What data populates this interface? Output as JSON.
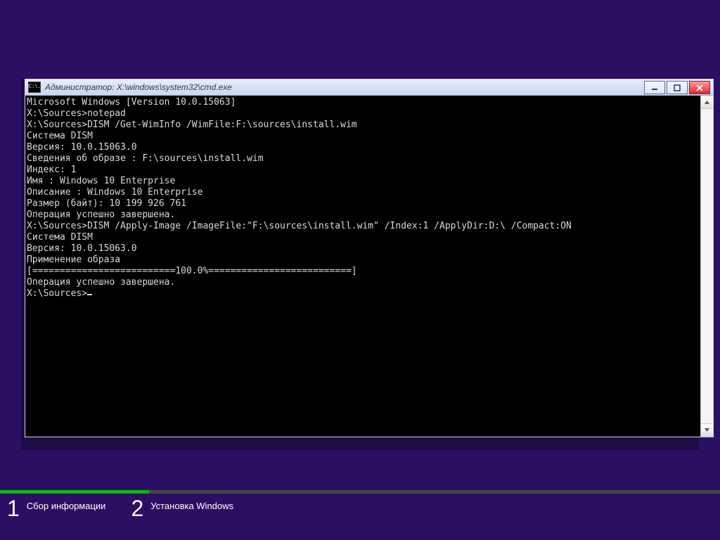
{
  "window": {
    "title": "Администратор: X:\\windows\\system32\\cmd.exe"
  },
  "console": {
    "lines": [
      "Microsoft Windows [Version 10.0.15063]",
      "",
      "X:\\Sources>notepad",
      "",
      "X:\\Sources>DISM /Get-WimInfo /WimFile:F:\\sources\\install.wim",
      "",
      "Cистема DISM",
      "Версия: 10.0.15063.0",
      "",
      "Сведения об образе : F:\\sources\\install.wim",
      "",
      "Индекс: 1",
      "Имя : Windows 10 Enterprise",
      "Описание : Windows 10 Enterprise",
      "Размер (байт): 10 199 926 761",
      "",
      "Операция успешно завершена.",
      "",
      "X:\\Sources>DISM /Apply-Image /ImageFile:\"F:\\sources\\install.wim\" /Index:1 /ApplyDir:D:\\ /Compact:ON",
      "",
      "Cистема DISM",
      "Версия: 10.0.15063.0",
      "",
      "Применение образа",
      "[==========================100.0%==========================]",
      "Операция успешно завершена.",
      "",
      "X:\\Sources>"
    ],
    "prompt_has_cursor": true
  },
  "icons": {
    "cmd_icon_text": "C:\\."
  },
  "setup_steps": {
    "step1": {
      "num": "1",
      "label": "Сбор информации"
    },
    "step2": {
      "num": "2",
      "label": "Установка Windows"
    }
  }
}
